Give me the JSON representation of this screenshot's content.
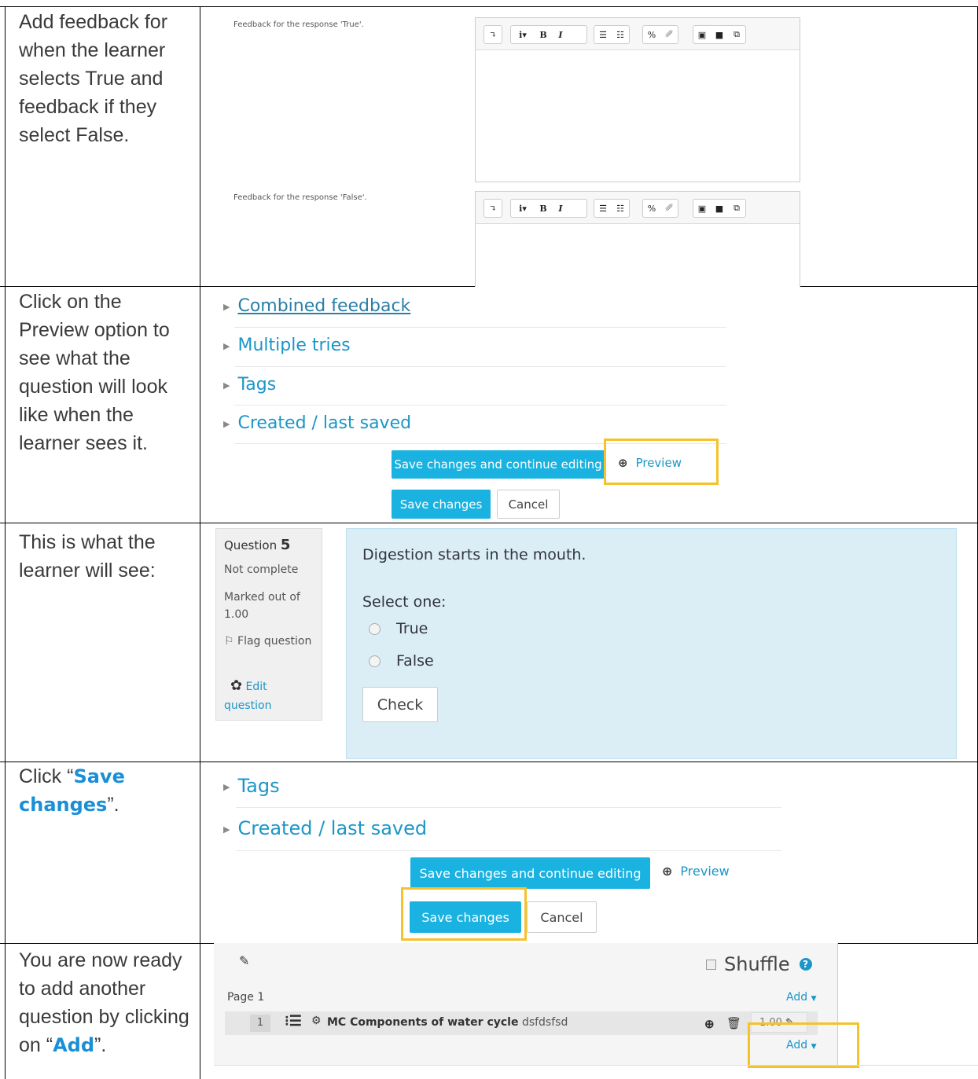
{
  "rows": {
    "r1": {
      "instruction": "Add feedback for when the learner selects True and feedback if they select False."
    },
    "r2": {
      "instruction": "Click on the Preview option to see what the question will look like when the learner sees it."
    },
    "r3": {
      "instruction": "This is what the learner will see:"
    },
    "r4": {
      "instruction_pre": "Click “",
      "instruction_hl": "Save changes",
      "instruction_post": "”."
    },
    "r5": {
      "instruction_pre": "You are now ready to add another question by clicking on “",
      "instruction_hl": "Add",
      "instruction_post": "”."
    }
  },
  "feedback": {
    "true_label": "Feedback for the response 'True'.",
    "false_label": "Feedback for the response 'False'."
  },
  "toolbar_icons": [
    "collapse-icon",
    "italic-menu-icon",
    "bold-icon",
    "italic-icon",
    "bullet-list-icon",
    "numbered-list-icon",
    "link-icon",
    "unlink-icon",
    "image-icon",
    "video-icon",
    "manage-files-icon"
  ],
  "form": {
    "sections": [
      "Combined feedback",
      "Multiple tries",
      "Tags",
      "Created / last saved"
    ],
    "sections_short": [
      "Tags",
      "Created / last saved"
    ],
    "save_continue": "Save changes and continue editing",
    "preview": "Preview",
    "save": "Save changes",
    "cancel": "Cancel"
  },
  "question": {
    "label": "Question",
    "number": "5",
    "state": "Not complete",
    "marked": "Marked out of 1.00",
    "flag": "Flag question",
    "edit": "Edit question",
    "text": "Digestion starts in the mouth.",
    "select": "Select one:",
    "options": [
      "True",
      "False"
    ],
    "check": "Check"
  },
  "quiz": {
    "shuffle": "Shuffle",
    "page": "Page 1",
    "add": "Add",
    "slot_number": "1",
    "question_name": "MC Components of water cycle",
    "question_text": "dsfdsfsd",
    "mark": "1.00"
  }
}
